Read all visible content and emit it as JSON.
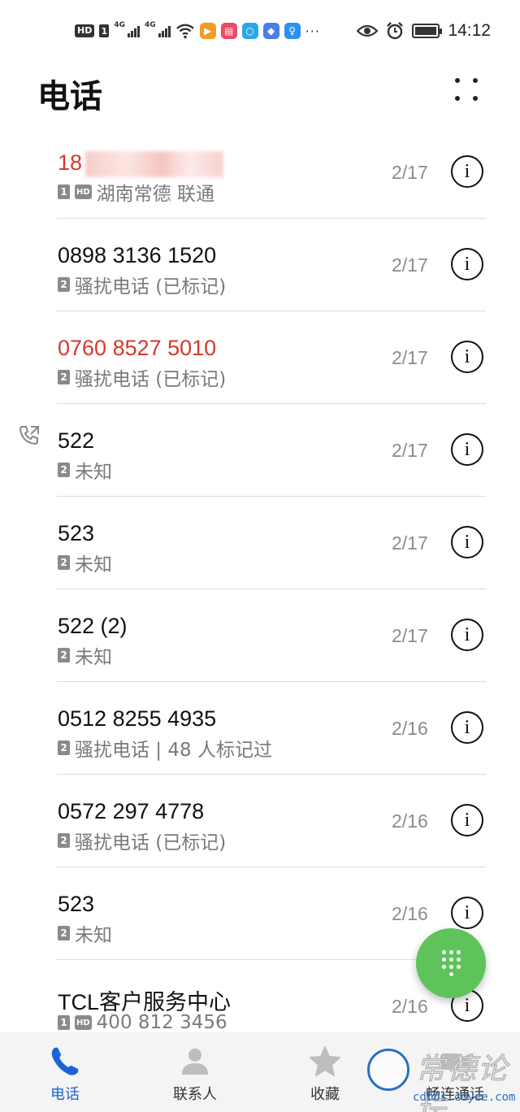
{
  "status_bar": {
    "hd_label": "HD",
    "sim1_label": "1",
    "net1": "4G",
    "net2": "4G",
    "more": "···",
    "time": "14:12",
    "icons": [
      "wifi-icon",
      "video-app-icon",
      "book-app-icon",
      "search-app-icon",
      "education-app-icon",
      "bulb-app-icon",
      "eye-icon",
      "alarm-icon",
      "battery-icon"
    ]
  },
  "header": {
    "title": "电话"
  },
  "calls": [
    {
      "number": "18",
      "sub_text": "湖南常德 联通",
      "sim": "1",
      "hd": "HD",
      "date": "2/17",
      "missed": true
    },
    {
      "number": "0898 3136 1520",
      "sub_text": "骚扰电话 (已标记)",
      "sim": "2",
      "date": "2/17",
      "missed": false
    },
    {
      "number": "0760 8527 5010",
      "sub_text": "骚扰电话 (已标记)",
      "sim": "2",
      "date": "2/17",
      "missed": true
    },
    {
      "number": "522",
      "sub_text": "未知",
      "sim": "2",
      "date": "2/17",
      "missed": false,
      "outgoing": true
    },
    {
      "number": "523",
      "sub_text": "未知",
      "sim": "2",
      "date": "2/17",
      "missed": false
    },
    {
      "number": "522 (2)",
      "sub_text": "未知",
      "sim": "2",
      "date": "2/17",
      "missed": false
    },
    {
      "number": "0512 8255 4935",
      "sub_text": "骚扰电话 | 48 人标记过",
      "sim": "2",
      "date": "2/16",
      "missed": false
    },
    {
      "number": "0572 297 4778",
      "sub_text": "骚扰电话 (已标记)",
      "sim": "2",
      "date": "2/16",
      "missed": false
    },
    {
      "number": "523",
      "sub_text": "未知",
      "sim": "2",
      "date": "2/16",
      "missed": false
    },
    {
      "number": "TCL客户服务中心",
      "sub_text": "400 812 3456",
      "sim": "1",
      "hd": "HD",
      "date": "2/16",
      "missed": false
    }
  ],
  "info_glyph": "i",
  "bottom_nav": {
    "items": [
      {
        "label": "电话",
        "icon": "phone-icon",
        "active": true
      },
      {
        "label": "联系人",
        "icon": "contacts-icon",
        "active": false
      },
      {
        "label": "收藏",
        "icon": "star-icon",
        "active": false
      },
      {
        "label": "畅连通话",
        "icon": "video-call-icon",
        "active": false
      }
    ]
  },
  "watermark": {
    "text": "常德论坛",
    "url": "cdbbs.cdyee.com"
  },
  "colors": {
    "missed": "#d33a2c",
    "accent": "#1a64d6",
    "fab": "#5ec35a"
  }
}
